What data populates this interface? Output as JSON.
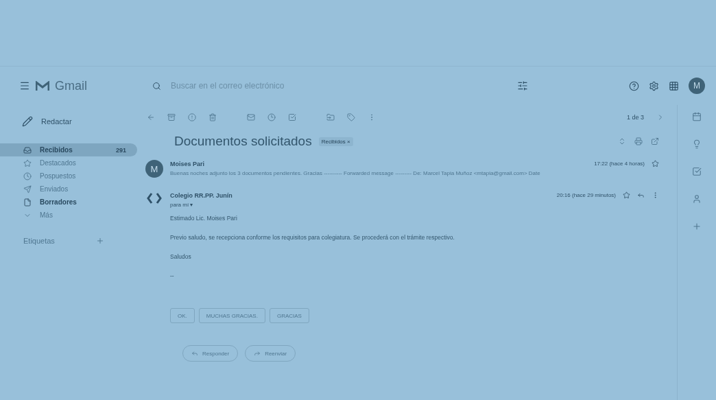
{
  "app": {
    "name": "Gmail"
  },
  "account": {
    "initial": "M"
  },
  "compose": {
    "label": "Redactar"
  },
  "folders": [
    {
      "label": "Recibidos",
      "count": "291",
      "selected": true,
      "bold": true
    },
    {
      "label": "Destacados",
      "selected": false,
      "bold": false
    },
    {
      "label": "Pospuestos",
      "selected": false,
      "bold": false
    },
    {
      "label": "Enviados",
      "selected": false,
      "bold": false
    },
    {
      "label": "Borradores",
      "selected": false,
      "bold": true
    },
    {
      "label": "Más",
      "selected": false,
      "bold": false
    }
  ],
  "labels_heading": "Etiquetas",
  "search": {
    "placeholder": "Buscar en el correo electrónico"
  },
  "pager": {
    "text": "1 de 3"
  },
  "thread": {
    "subject": "Documentos solicitados",
    "tag": "Recibidos ×",
    "messages": [
      {
        "kind": "collapsed",
        "sender": "Moises Pari",
        "avatar": "M",
        "snippet": "Buenas noches adjunto los 3 documentos pendientes. Gracias ---------- Forwarded message --------- De: Marcel Tapia Muñoz <mtapia@gmail.com> Date",
        "time": "17:22 (hace 4 horas)"
      },
      {
        "kind": "expanded",
        "sender": "Colegio RR.PP. Junín",
        "recipient": "para mí ▾",
        "time": "20:16 (hace 29 minutos)",
        "body": [
          "Estimado Lic. Moises Pari",
          "Previo saludo, se recepciona conforme los requisitos para colegiatura. Se procederá con el trámite respectivo.",
          "Saludos",
          "--"
        ],
        "smart_replies": [
          "OK.",
          "MUCHAS GRACIAS.",
          "GRACIAS"
        ]
      }
    ],
    "actions": [
      "Responder",
      "Reenviar"
    ]
  }
}
